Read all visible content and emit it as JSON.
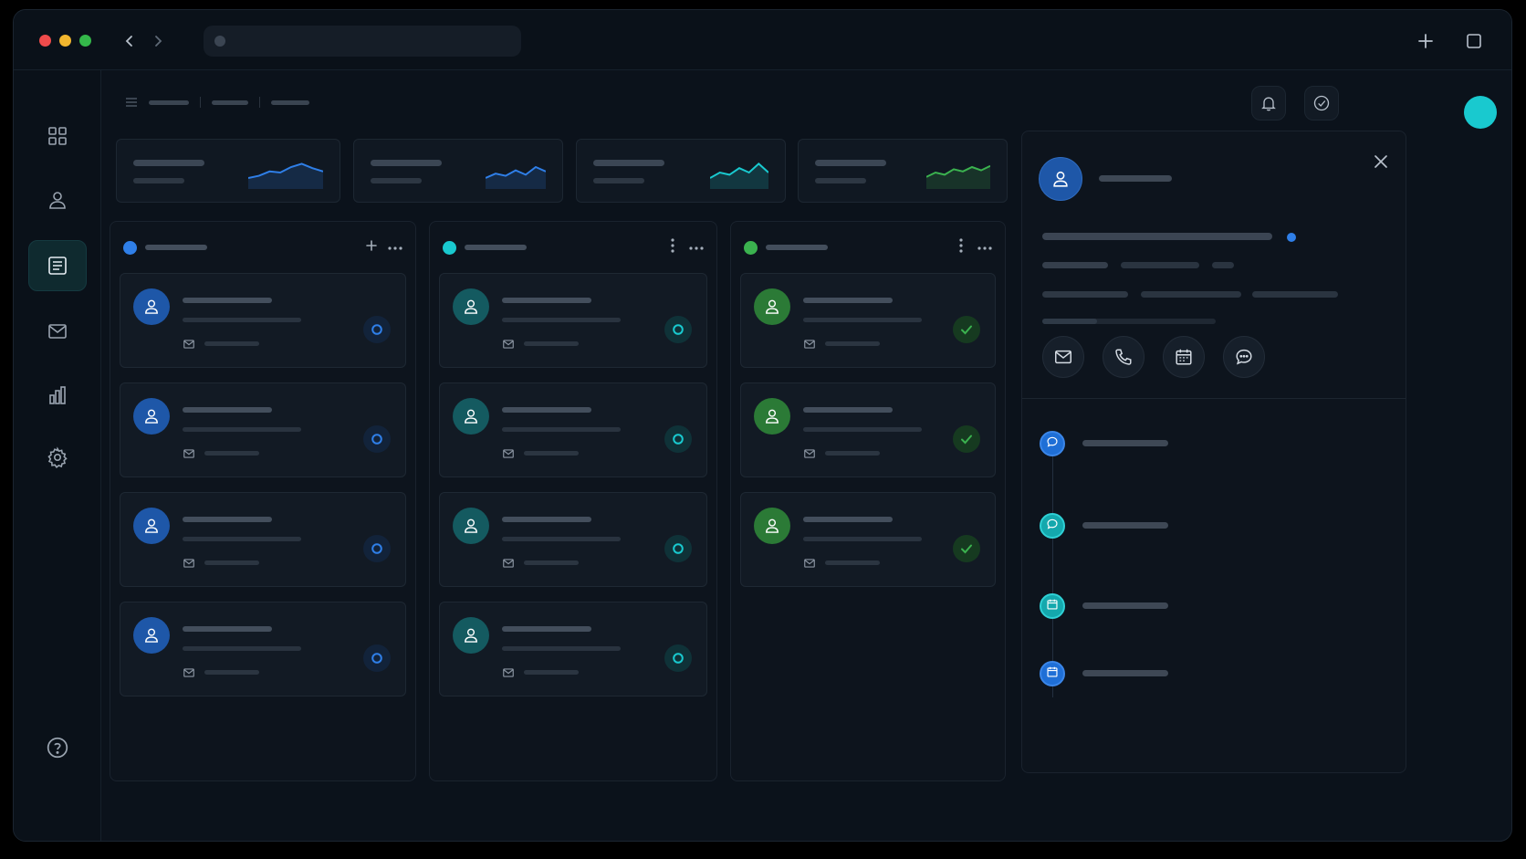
{
  "colors": {
    "accent_blue": "#2f7fe8",
    "accent_teal": "#19c9cf",
    "accent_green": "#3bb24f",
    "bg": "#0b121b"
  },
  "titlebar": {
    "traffic_lights": [
      "#ef4b4b",
      "#f2b62e",
      "#34b84a"
    ],
    "icons": [
      "chevron-left-icon",
      "chevron-right-icon",
      "plus-icon",
      "square-icon"
    ]
  },
  "sidebar": {
    "items": [
      "grid-icon",
      "user-icon",
      "list-icon",
      "mail-icon",
      "chart-icon",
      "gear-icon"
    ],
    "active_index": 2,
    "footer": "help-icon"
  },
  "header": {
    "icons": [
      "bell-icon",
      "check-circle-icon",
      "avatar"
    ]
  },
  "stats": [
    {
      "trend_color": "#2f7fe8"
    },
    {
      "trend_color": "#2f7fe8"
    },
    {
      "trend_color": "#19c9cf"
    },
    {
      "trend_color": "#3bb24f"
    }
  ],
  "columns": [
    {
      "color": "#2f7fe8",
      "actions": [
        "plus-icon",
        "more-horizontal-icon"
      ],
      "cards": 4,
      "status": "circle"
    },
    {
      "color": "#19c9cf",
      "actions": [
        "more-vertical-icon",
        "more-horizontal-icon"
      ],
      "cards": 4,
      "status": "circle"
    },
    {
      "color": "#3bb24f",
      "actions": [
        "more-vertical-icon",
        "more-horizontal-icon"
      ],
      "cards": 3,
      "status": "check"
    }
  ],
  "detail": {
    "actions": [
      "mail-icon",
      "phone-icon",
      "calendar-icon",
      "chat-icon"
    ],
    "timeline": [
      {
        "icon": "chat-icon",
        "color": "#1f6fd6"
      },
      {
        "icon": "chat-icon",
        "color": "#14a8ad"
      },
      {
        "icon": "calendar-icon",
        "color": "#14a8ad"
      },
      {
        "icon": "calendar-icon",
        "color": "#1f6fd6"
      }
    ]
  }
}
